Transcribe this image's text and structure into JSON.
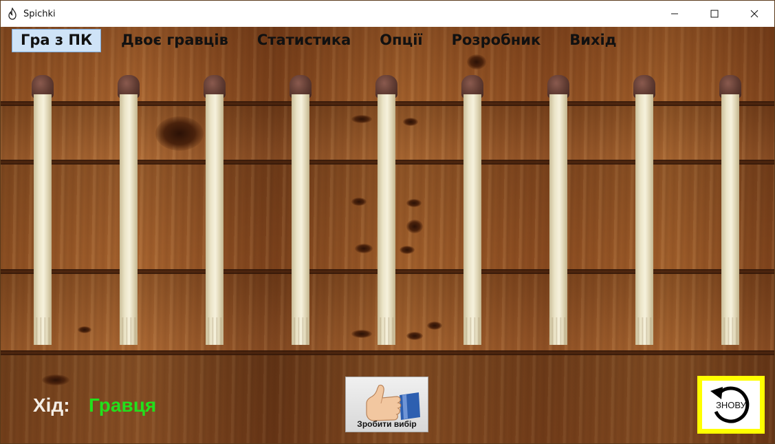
{
  "window": {
    "title": "Spichki",
    "icon": "flame-icon",
    "controls": {
      "minimize": "—",
      "maximize": "☐",
      "close": "✕"
    }
  },
  "menu": {
    "items": [
      {
        "label": "Гра з ПК",
        "active": true
      },
      {
        "label": "Двоє гравців",
        "active": false
      },
      {
        "label": "Статистика",
        "active": false
      },
      {
        "label": "Опції",
        "active": false
      },
      {
        "label": "Розробник",
        "active": false
      },
      {
        "label": "Вихід",
        "active": false
      }
    ]
  },
  "board": {
    "match_count": 9
  },
  "status": {
    "turn_label": "Хід:",
    "turn_value": "Гравця",
    "turn_value_color": "#22e01c"
  },
  "actions": {
    "make_choice_label": "Зробити вибір",
    "again_label": "ЗНОВУ",
    "again_frame_color": "#ffff00"
  }
}
